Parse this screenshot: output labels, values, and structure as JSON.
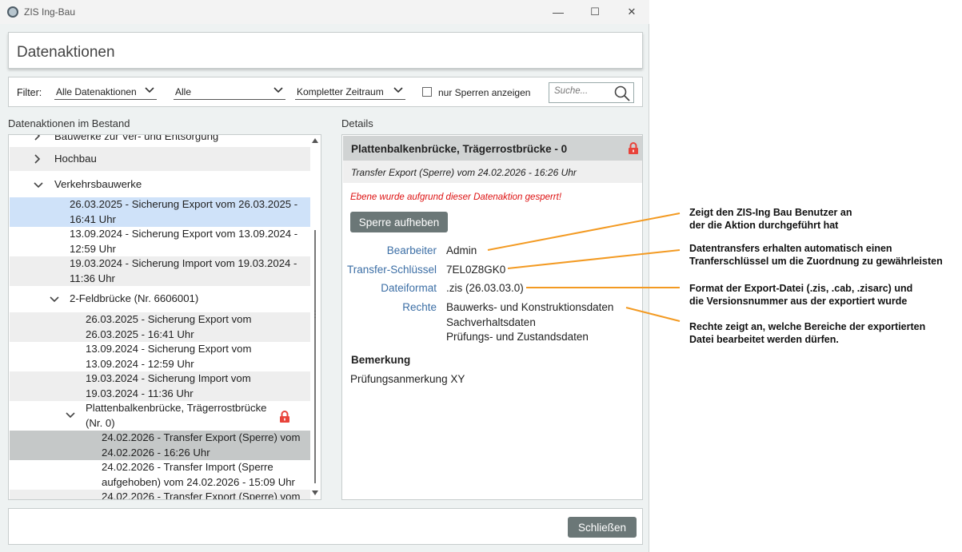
{
  "window": {
    "title": "ZIS Ing-Bau",
    "minimize_glyph": "—",
    "maximize_glyph": "☐",
    "close_glyph": "✕"
  },
  "header": {
    "title": "Datenaktionen"
  },
  "filter": {
    "label": "Filter:",
    "action_type": "Alle Datenaktionen",
    "scope": "Alle",
    "period": "Kompletter Zeitraum",
    "only_locks_label": "nur Sperren anzeigen",
    "only_locks_checked": false,
    "search_placeholder": "Suche..."
  },
  "tree": {
    "section_label": "Datenaktionen im Bestand",
    "rows": [
      {
        "text": "Bauwerke zur Ver- und Entsorgung"
      },
      {
        "text": "Hochbau"
      },
      {
        "text": "Verkehrsbauwerke"
      },
      {
        "line1": "26.03.2025 - Sicherung Export vom 26.03.2025 -",
        "line2": "16:41 Uhr"
      },
      {
        "line1": "13.09.2024 - Sicherung Export vom 13.09.2024 -",
        "line2": "12:59 Uhr"
      },
      {
        "line1": "19.03.2024 - Sicherung Import vom 19.03.2024 -",
        "line2": "11:36 Uhr"
      },
      {
        "text": "2-Feldbrücke (Nr. 6606001)"
      },
      {
        "line1": "26.03.2025 - Sicherung Export vom",
        "line2": "26.03.2025 - 16:41 Uhr"
      },
      {
        "line1": "13.09.2024 - Sicherung Export vom",
        "line2": "13.09.2024 - 12:59 Uhr"
      },
      {
        "line1": "19.03.2024 - Sicherung Import vom",
        "line2": "19.03.2024 - 11:36 Uhr"
      },
      {
        "line1": "Plattenbalkenbrücke, Trägerrostbrücke",
        "line2": "(Nr. 0)"
      },
      {
        "line1": "24.02.2026 - Transfer Export (Sperre) vom",
        "line2": "24.02.2026 - 16:26 Uhr"
      },
      {
        "line1": "24.02.2026 - Transfer Import (Sperre",
        "line2": "aufgehoben) vom 24.02.2026 - 15:09 Uhr"
      },
      {
        "text": "24.02.2026 - Transfer Export (Sperre) vom"
      }
    ]
  },
  "details": {
    "section_label": "Details",
    "title": "Plattenbalkenbrücke, Trägerrostbrücke - 0",
    "subtitle": "Transfer Export (Sperre) vom 24.02.2026 - 16:26 Uhr",
    "warning": "Ebene wurde aufgrund dieser Datenaktion gesperrt!",
    "unlock_button": "Sperre aufheben",
    "fields": {
      "editor_label": "Bearbeiter",
      "editor_value": "Admin",
      "key_label": "Transfer-Schlüssel",
      "key_value": "7EL0Z8GK0",
      "format_label": "Dateiformat",
      "format_value": ".zis (26.03.03.0)",
      "rights_label": "Rechte",
      "rights_values": [
        "Bauwerks- und Konstruktionsdaten",
        "Sachverhaltsdaten",
        "Prüfungs- und Zustandsdaten"
      ]
    },
    "remark_label": "Bemerkung",
    "remark_value": "Prüfungsanmerkung XY"
  },
  "footer": {
    "close_button": "Schließen"
  },
  "annotations": [
    {
      "line1": "Zeigt den ZIS-Ing Bau Benutzer an",
      "line2": "der die Aktion durchgeführt hat"
    },
    {
      "line1": "Datentransfers erhalten automatisch einen",
      "line2": "Tranferschlüssel um die Zuordnung zu gewährleisten"
    },
    {
      "line1": "Format der Export-Datei (.zis, .cab, .zisarc) und",
      "line2": "die Versionsnummer aus der exportiert wurde"
    },
    {
      "line1": "Rechte zeigt an, welche Bereiche der exportierten",
      "line2": "Datei bearbeitet werden dürfen."
    }
  ],
  "colors": {
    "accent": "#3b6ea5",
    "button": "#6b7777",
    "selection": "#cfe2f9",
    "warning": "#dd1111",
    "lock": "#e8433a",
    "callout_line": "#f39a22"
  }
}
